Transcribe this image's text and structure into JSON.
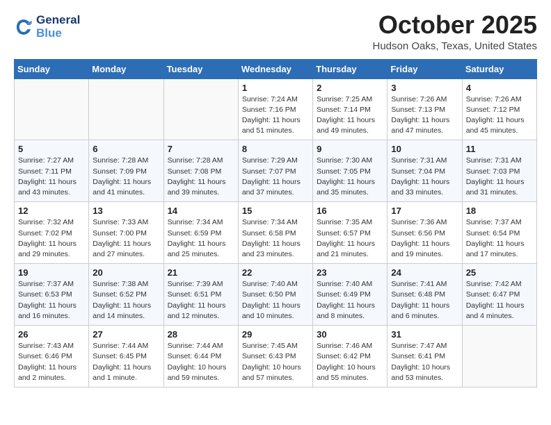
{
  "header": {
    "logo_line1": "General",
    "logo_line2": "Blue",
    "month": "October 2025",
    "location": "Hudson Oaks, Texas, United States"
  },
  "days_of_week": [
    "Sunday",
    "Monday",
    "Tuesday",
    "Wednesday",
    "Thursday",
    "Friday",
    "Saturday"
  ],
  "weeks": [
    [
      {
        "day": "",
        "sunrise": "",
        "sunset": "",
        "daylight": ""
      },
      {
        "day": "",
        "sunrise": "",
        "sunset": "",
        "daylight": ""
      },
      {
        "day": "",
        "sunrise": "",
        "sunset": "",
        "daylight": ""
      },
      {
        "day": "1",
        "sunrise": "Sunrise: 7:24 AM",
        "sunset": "Sunset: 7:16 PM",
        "daylight": "Daylight: 11 hours and 51 minutes."
      },
      {
        "day": "2",
        "sunrise": "Sunrise: 7:25 AM",
        "sunset": "Sunset: 7:14 PM",
        "daylight": "Daylight: 11 hours and 49 minutes."
      },
      {
        "day": "3",
        "sunrise": "Sunrise: 7:26 AM",
        "sunset": "Sunset: 7:13 PM",
        "daylight": "Daylight: 11 hours and 47 minutes."
      },
      {
        "day": "4",
        "sunrise": "Sunrise: 7:26 AM",
        "sunset": "Sunset: 7:12 PM",
        "daylight": "Daylight: 11 hours and 45 minutes."
      }
    ],
    [
      {
        "day": "5",
        "sunrise": "Sunrise: 7:27 AM",
        "sunset": "Sunset: 7:11 PM",
        "daylight": "Daylight: 11 hours and 43 minutes."
      },
      {
        "day": "6",
        "sunrise": "Sunrise: 7:28 AM",
        "sunset": "Sunset: 7:09 PM",
        "daylight": "Daylight: 11 hours and 41 minutes."
      },
      {
        "day": "7",
        "sunrise": "Sunrise: 7:28 AM",
        "sunset": "Sunset: 7:08 PM",
        "daylight": "Daylight: 11 hours and 39 minutes."
      },
      {
        "day": "8",
        "sunrise": "Sunrise: 7:29 AM",
        "sunset": "Sunset: 7:07 PM",
        "daylight": "Daylight: 11 hours and 37 minutes."
      },
      {
        "day": "9",
        "sunrise": "Sunrise: 7:30 AM",
        "sunset": "Sunset: 7:05 PM",
        "daylight": "Daylight: 11 hours and 35 minutes."
      },
      {
        "day": "10",
        "sunrise": "Sunrise: 7:31 AM",
        "sunset": "Sunset: 7:04 PM",
        "daylight": "Daylight: 11 hours and 33 minutes."
      },
      {
        "day": "11",
        "sunrise": "Sunrise: 7:31 AM",
        "sunset": "Sunset: 7:03 PM",
        "daylight": "Daylight: 11 hours and 31 minutes."
      }
    ],
    [
      {
        "day": "12",
        "sunrise": "Sunrise: 7:32 AM",
        "sunset": "Sunset: 7:02 PM",
        "daylight": "Daylight: 11 hours and 29 minutes."
      },
      {
        "day": "13",
        "sunrise": "Sunrise: 7:33 AM",
        "sunset": "Sunset: 7:00 PM",
        "daylight": "Daylight: 11 hours and 27 minutes."
      },
      {
        "day": "14",
        "sunrise": "Sunrise: 7:34 AM",
        "sunset": "Sunset: 6:59 PM",
        "daylight": "Daylight: 11 hours and 25 minutes."
      },
      {
        "day": "15",
        "sunrise": "Sunrise: 7:34 AM",
        "sunset": "Sunset: 6:58 PM",
        "daylight": "Daylight: 11 hours and 23 minutes."
      },
      {
        "day": "16",
        "sunrise": "Sunrise: 7:35 AM",
        "sunset": "Sunset: 6:57 PM",
        "daylight": "Daylight: 11 hours and 21 minutes."
      },
      {
        "day": "17",
        "sunrise": "Sunrise: 7:36 AM",
        "sunset": "Sunset: 6:56 PM",
        "daylight": "Daylight: 11 hours and 19 minutes."
      },
      {
        "day": "18",
        "sunrise": "Sunrise: 7:37 AM",
        "sunset": "Sunset: 6:54 PM",
        "daylight": "Daylight: 11 hours and 17 minutes."
      }
    ],
    [
      {
        "day": "19",
        "sunrise": "Sunrise: 7:37 AM",
        "sunset": "Sunset: 6:53 PM",
        "daylight": "Daylight: 11 hours and 16 minutes."
      },
      {
        "day": "20",
        "sunrise": "Sunrise: 7:38 AM",
        "sunset": "Sunset: 6:52 PM",
        "daylight": "Daylight: 11 hours and 14 minutes."
      },
      {
        "day": "21",
        "sunrise": "Sunrise: 7:39 AM",
        "sunset": "Sunset: 6:51 PM",
        "daylight": "Daylight: 11 hours and 12 minutes."
      },
      {
        "day": "22",
        "sunrise": "Sunrise: 7:40 AM",
        "sunset": "Sunset: 6:50 PM",
        "daylight": "Daylight: 11 hours and 10 minutes."
      },
      {
        "day": "23",
        "sunrise": "Sunrise: 7:40 AM",
        "sunset": "Sunset: 6:49 PM",
        "daylight": "Daylight: 11 hours and 8 minutes."
      },
      {
        "day": "24",
        "sunrise": "Sunrise: 7:41 AM",
        "sunset": "Sunset: 6:48 PM",
        "daylight": "Daylight: 11 hours and 6 minutes."
      },
      {
        "day": "25",
        "sunrise": "Sunrise: 7:42 AM",
        "sunset": "Sunset: 6:47 PM",
        "daylight": "Daylight: 11 hours and 4 minutes."
      }
    ],
    [
      {
        "day": "26",
        "sunrise": "Sunrise: 7:43 AM",
        "sunset": "Sunset: 6:46 PM",
        "daylight": "Daylight: 11 hours and 2 minutes."
      },
      {
        "day": "27",
        "sunrise": "Sunrise: 7:44 AM",
        "sunset": "Sunset: 6:45 PM",
        "daylight": "Daylight: 11 hours and 1 minute."
      },
      {
        "day": "28",
        "sunrise": "Sunrise: 7:44 AM",
        "sunset": "Sunset: 6:44 PM",
        "daylight": "Daylight: 10 hours and 59 minutes."
      },
      {
        "day": "29",
        "sunrise": "Sunrise: 7:45 AM",
        "sunset": "Sunset: 6:43 PM",
        "daylight": "Daylight: 10 hours and 57 minutes."
      },
      {
        "day": "30",
        "sunrise": "Sunrise: 7:46 AM",
        "sunset": "Sunset: 6:42 PM",
        "daylight": "Daylight: 10 hours and 55 minutes."
      },
      {
        "day": "31",
        "sunrise": "Sunrise: 7:47 AM",
        "sunset": "Sunset: 6:41 PM",
        "daylight": "Daylight: 10 hours and 53 minutes."
      },
      {
        "day": "",
        "sunrise": "",
        "sunset": "",
        "daylight": ""
      }
    ]
  ]
}
